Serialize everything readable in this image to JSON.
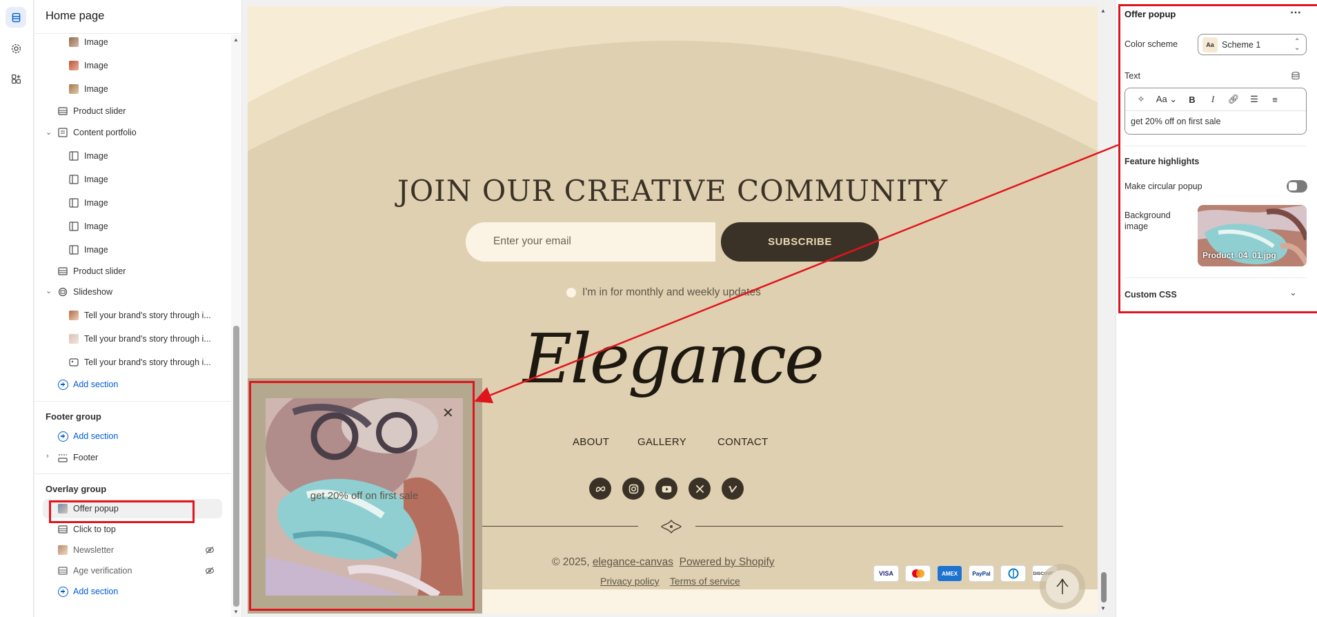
{
  "left_panel": {
    "title": "Home page",
    "tree": [
      {
        "label": "Image",
        "kind": "image-thumb"
      },
      {
        "label": "Image",
        "kind": "image-thumb"
      },
      {
        "label": "Image",
        "kind": "image-thumb"
      },
      {
        "label": "Product slider",
        "kind": "section"
      },
      {
        "label": "Content portfolio",
        "kind": "section-expanded"
      },
      {
        "label": "Image",
        "kind": "block"
      },
      {
        "label": "Image",
        "kind": "block"
      },
      {
        "label": "Image",
        "kind": "block"
      },
      {
        "label": "Image",
        "kind": "block"
      },
      {
        "label": "Image",
        "kind": "block"
      },
      {
        "label": "Product slider",
        "kind": "section"
      },
      {
        "label": "Slideshow",
        "kind": "section-expanded"
      },
      {
        "label": "Tell your brand's story through i...",
        "kind": "slide-thumb"
      },
      {
        "label": "Tell your brand's story through i...",
        "kind": "slide-thumb"
      },
      {
        "label": "Tell your brand's story through i...",
        "kind": "slide-block"
      }
    ],
    "add_section_label": "Add section",
    "footer_group": {
      "title": "Footer group",
      "add_label": "Add section",
      "item": "Footer"
    },
    "overlay_group": {
      "title": "Overlay group",
      "items": [
        "Offer popup",
        "Click to top",
        "Newsletter",
        "Age verification"
      ],
      "add_label": "Add section"
    }
  },
  "preview": {
    "headline": "JOIN OUR CREATIVE COMMUNITY",
    "email_placeholder": "Enter your email",
    "subscribe_label": "SUBSCRIBE",
    "consent_label": "I'm in for monthly and weekly updates",
    "logo_text": "Elegance",
    "nav": [
      "ABOUT",
      "GALLERY",
      "CONTACT"
    ],
    "social_icons": [
      "meta-icon",
      "instagram-icon",
      "youtube-icon",
      "x-icon",
      "vimeo-icon"
    ],
    "copyright_prefix": "© 2025,",
    "store_link": "elegance-canvas",
    "powered_by": "Powered by Shopify",
    "privacy": "Privacy policy",
    "terms": "Terms of service",
    "payments": [
      "VISA",
      "MC",
      "AMEX",
      "PayPal",
      "Diners",
      "DISCOVER"
    ],
    "popup_text": "get 20% off on first sale",
    "popup_close": "✕"
  },
  "right_panel": {
    "title": "Offer popup",
    "more": "⋯",
    "color_scheme_label": "Color scheme",
    "color_scheme_value": "Scheme 1",
    "text_label": "Text",
    "text_value": "get 20% off on first sale",
    "feature_title": "Feature highlights",
    "circular_label": "Make circular popup",
    "circular_on": false,
    "bg_label": "Background image",
    "bg_file": "Product_04_01.jpg",
    "custom_css": "Custom CSS"
  },
  "colors": {
    "accent": "#005bd3",
    "annotation_red": "#e0141c",
    "preview_bg": "#dfd0b1",
    "dark_brown": "#3a3226"
  }
}
